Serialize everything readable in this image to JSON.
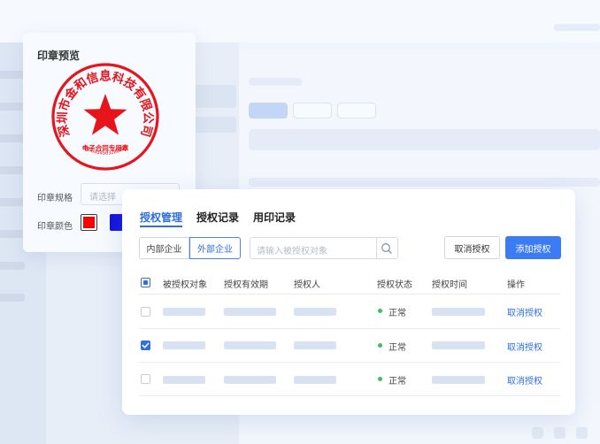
{
  "seal_card": {
    "title": "印章预览",
    "seal_company": "深圳市金和信息科技有限公司",
    "seal_subtitle": "电子合同专用章",
    "seal_serial": "4403034503288004",
    "spec_label": "印章规格",
    "spec_placeholder": "请选择",
    "color_label": "印章颜色",
    "colors": [
      "#ff0000",
      "#1111dd"
    ],
    "selected_color": "#ff0000"
  },
  "auth_card": {
    "tabs": [
      {
        "label": "授权管理",
        "active": true
      },
      {
        "label": "授权记录",
        "active": false
      },
      {
        "label": "用印记录",
        "active": false
      }
    ],
    "segments": [
      {
        "label": "内部企业",
        "active": false
      },
      {
        "label": "外部企业",
        "active": true
      }
    ],
    "search_placeholder": "请输入被授权对象",
    "cancel_button": "取消授权",
    "add_button": "添加授权",
    "columns": [
      "被授权对象",
      "授权有效期",
      "授权人",
      "授权状态",
      "授权时间",
      "操作"
    ],
    "rows": [
      {
        "checked": false,
        "status": "正常",
        "action": "取消授权"
      },
      {
        "checked": true,
        "status": "正常",
        "action": "取消授权"
      },
      {
        "checked": false,
        "status": "正常",
        "action": "取消授权"
      }
    ]
  },
  "colors": {
    "accent": "#2f6fe0",
    "primary_button": "#3b7cf4",
    "status_ok": "#3cbf63",
    "seal_red": "#ff0000"
  }
}
